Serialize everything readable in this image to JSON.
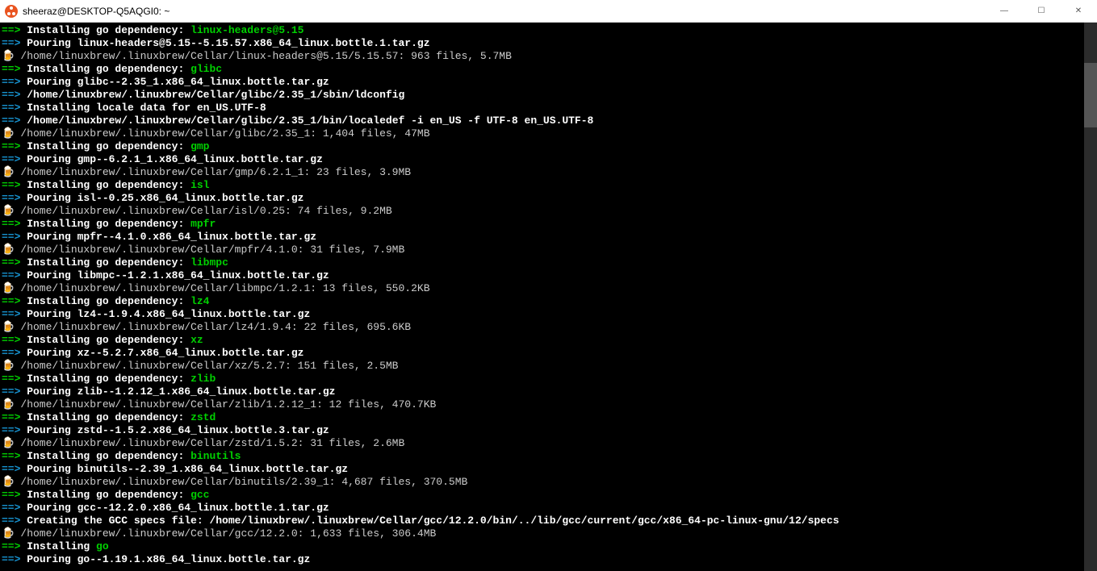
{
  "window": {
    "title": "sheeraz@DESKTOP-Q5AQGI0: ~",
    "min_icon": "―",
    "max_icon": "☐",
    "close_icon": "✕"
  },
  "symbols": {
    "arrow": "==>",
    "box": "🍺"
  },
  "lines": [
    {
      "type": "install",
      "prefix_text": "Installing go dependency: ",
      "pkg": "linux-headers@5.15"
    },
    {
      "type": "pour",
      "text": "Pouring linux-headers@5.15--5.15.57.x86_64_linux.bottle.1.tar.gz"
    },
    {
      "type": "summary",
      "text": "/home/linuxbrew/.linuxbrew/Cellar/linux-headers@5.15/5.15.57: 963 files, 5.7MB"
    },
    {
      "type": "install",
      "prefix_text": "Installing go dependency: ",
      "pkg": "glibc"
    },
    {
      "type": "pour",
      "text": "Pouring glibc--2.35_1.x86_64_linux.bottle.tar.gz"
    },
    {
      "type": "step",
      "text": "/home/linuxbrew/.linuxbrew/Cellar/glibc/2.35_1/sbin/ldconfig"
    },
    {
      "type": "step",
      "text": "Installing locale data for en_US.UTF-8"
    },
    {
      "type": "step",
      "text": "/home/linuxbrew/.linuxbrew/Cellar/glibc/2.35_1/bin/localedef -i en_US -f UTF-8 en_US.UTF-8"
    },
    {
      "type": "summary",
      "text": "/home/linuxbrew/.linuxbrew/Cellar/glibc/2.35_1: 1,404 files, 47MB"
    },
    {
      "type": "install",
      "prefix_text": "Installing go dependency: ",
      "pkg": "gmp"
    },
    {
      "type": "pour",
      "text": "Pouring gmp--6.2.1_1.x86_64_linux.bottle.tar.gz"
    },
    {
      "type": "summary",
      "text": "/home/linuxbrew/.linuxbrew/Cellar/gmp/6.2.1_1: 23 files, 3.9MB"
    },
    {
      "type": "install",
      "prefix_text": "Installing go dependency: ",
      "pkg": "isl"
    },
    {
      "type": "pour",
      "text": "Pouring isl--0.25.x86_64_linux.bottle.tar.gz"
    },
    {
      "type": "summary",
      "text": "/home/linuxbrew/.linuxbrew/Cellar/isl/0.25: 74 files, 9.2MB"
    },
    {
      "type": "install",
      "prefix_text": "Installing go dependency: ",
      "pkg": "mpfr"
    },
    {
      "type": "pour",
      "text": "Pouring mpfr--4.1.0.x86_64_linux.bottle.tar.gz"
    },
    {
      "type": "summary",
      "text": "/home/linuxbrew/.linuxbrew/Cellar/mpfr/4.1.0: 31 files, 7.9MB"
    },
    {
      "type": "install",
      "prefix_text": "Installing go dependency: ",
      "pkg": "libmpc"
    },
    {
      "type": "pour",
      "text": "Pouring libmpc--1.2.1.x86_64_linux.bottle.tar.gz"
    },
    {
      "type": "summary",
      "text": "/home/linuxbrew/.linuxbrew/Cellar/libmpc/1.2.1: 13 files, 550.2KB"
    },
    {
      "type": "install",
      "prefix_text": "Installing go dependency: ",
      "pkg": "lz4"
    },
    {
      "type": "pour",
      "text": "Pouring lz4--1.9.4.x86_64_linux.bottle.tar.gz"
    },
    {
      "type": "summary",
      "text": "/home/linuxbrew/.linuxbrew/Cellar/lz4/1.9.4: 22 files, 695.6KB"
    },
    {
      "type": "install",
      "prefix_text": "Installing go dependency: ",
      "pkg": "xz"
    },
    {
      "type": "pour",
      "text": "Pouring xz--5.2.7.x86_64_linux.bottle.tar.gz"
    },
    {
      "type": "summary",
      "text": "/home/linuxbrew/.linuxbrew/Cellar/xz/5.2.7: 151 files, 2.5MB"
    },
    {
      "type": "install",
      "prefix_text": "Installing go dependency: ",
      "pkg": "zlib"
    },
    {
      "type": "pour",
      "text": "Pouring zlib--1.2.12_1.x86_64_linux.bottle.tar.gz"
    },
    {
      "type": "summary",
      "text": "/home/linuxbrew/.linuxbrew/Cellar/zlib/1.2.12_1: 12 files, 470.7KB"
    },
    {
      "type": "install",
      "prefix_text": "Installing go dependency: ",
      "pkg": "zstd"
    },
    {
      "type": "pour",
      "text": "Pouring zstd--1.5.2.x86_64_linux.bottle.3.tar.gz"
    },
    {
      "type": "summary",
      "text": "/home/linuxbrew/.linuxbrew/Cellar/zstd/1.5.2: 31 files, 2.6MB"
    },
    {
      "type": "install",
      "prefix_text": "Installing go dependency: ",
      "pkg": "binutils"
    },
    {
      "type": "pour",
      "text": "Pouring binutils--2.39_1.x86_64_linux.bottle.tar.gz"
    },
    {
      "type": "summary",
      "text": "/home/linuxbrew/.linuxbrew/Cellar/binutils/2.39_1: 4,687 files, 370.5MB"
    },
    {
      "type": "install",
      "prefix_text": "Installing go dependency: ",
      "pkg": "gcc"
    },
    {
      "type": "pour",
      "text": "Pouring gcc--12.2.0.x86_64_linux.bottle.1.tar.gz"
    },
    {
      "type": "step",
      "text": "Creating the GCC specs file: /home/linuxbrew/.linuxbrew/Cellar/gcc/12.2.0/bin/../lib/gcc/current/gcc/x86_64-pc-linux-gnu/12/specs"
    },
    {
      "type": "summary",
      "text": "/home/linuxbrew/.linuxbrew/Cellar/gcc/12.2.0: 1,633 files, 306.4MB"
    },
    {
      "type": "install-plain",
      "prefix_text": "Installing ",
      "pkg": "go"
    },
    {
      "type": "pour",
      "text": "Pouring go--1.19.1.x86_64_linux.bottle.tar.gz"
    }
  ]
}
